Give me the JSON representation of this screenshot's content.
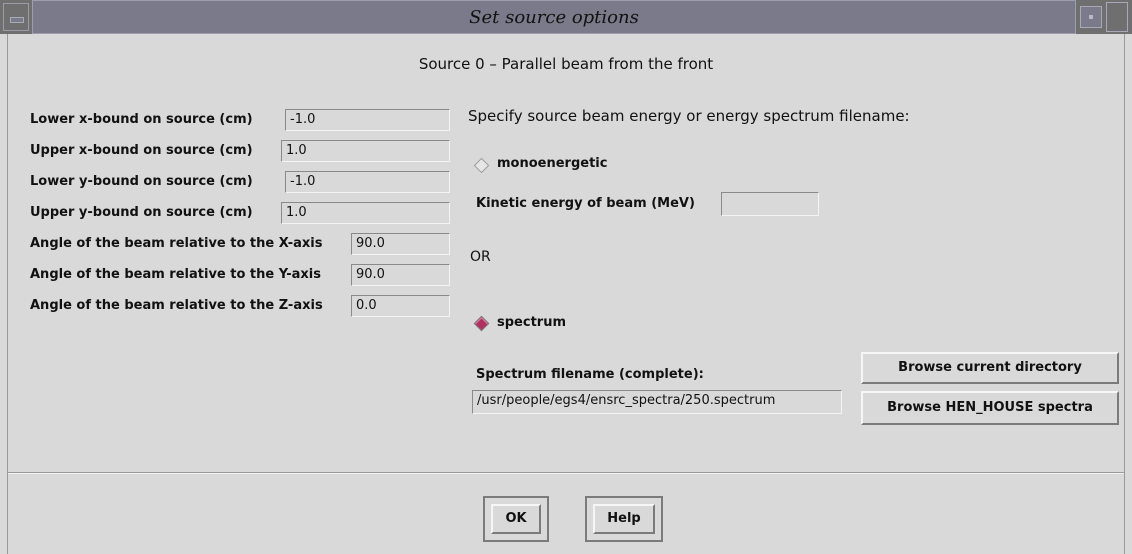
{
  "window": {
    "title": "Set source options"
  },
  "header": "Source 0 – Parallel beam from the front",
  "bounds": [
    {
      "label": "Lower x-bound on source (cm)",
      "value": "-1.0"
    },
    {
      "label": "Upper x-bound on source (cm)",
      "value": "1.0"
    },
    {
      "label": "Lower y-bound on source (cm)",
      "value": "-1.0"
    },
    {
      "label": "Upper y-bound on source (cm)",
      "value": "1.0"
    }
  ],
  "angles": [
    {
      "label": "Angle of the beam relative to the X-axis",
      "value": "90.0"
    },
    {
      "label": "Angle of the beam relative to the Y-axis",
      "value": "90.0"
    },
    {
      "label": "Angle of the beam relative to the Z-axis",
      "value": "0.0"
    }
  ],
  "energy": {
    "prompt": "Specify source beam energy or energy spectrum filename:",
    "mono_label": "monoenergetic",
    "mono_selected": false,
    "kinetic_label": "Kinetic energy of beam (MeV)",
    "kinetic_value": "",
    "or_label": "OR",
    "spectrum_label": "spectrum",
    "spectrum_selected": true,
    "filename_label": "Spectrum filename (complete):",
    "filename_value": "/usr/people/egs4/ensrc_spectra/250.spectrum",
    "browse_current": "Browse current directory",
    "browse_henhouse": "Browse HEN_HOUSE spectra"
  },
  "buttons": {
    "ok": "OK",
    "help": "Help"
  },
  "colors": {
    "window_bg": "#d9d9d9",
    "titlebar": "#7a7a8a",
    "radio_selected": "#b03060"
  }
}
